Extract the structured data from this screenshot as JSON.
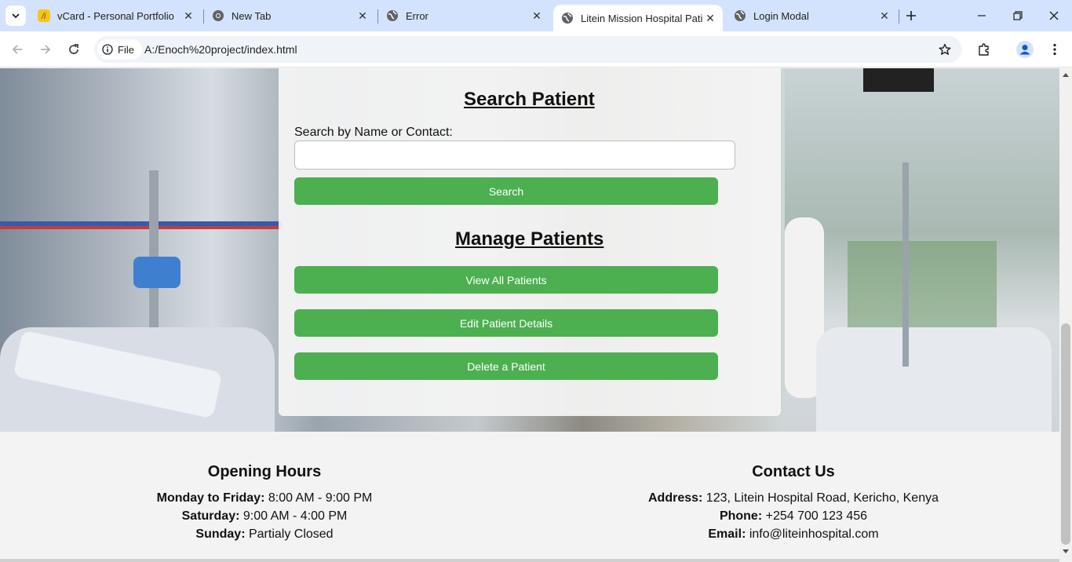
{
  "browser": {
    "tabs": [
      {
        "title": "vCard - Personal Portfolio",
        "icon": "vcard-favicon-icon",
        "active": false
      },
      {
        "title": "New Tab",
        "icon": "chrome-icon",
        "active": false
      },
      {
        "title": "Error",
        "icon": "globe-icon",
        "active": false
      },
      {
        "title": "Litein Mission Hospital Patie",
        "icon": "globe-icon",
        "active": true
      },
      {
        "title": "Login Modal",
        "icon": "globe-icon",
        "active": false
      }
    ],
    "site_info_label": "File",
    "url": "A:/Enoch%20project/index.html"
  },
  "search": {
    "title": "Search Patient",
    "label": "Search by Name or Contact:",
    "value": "",
    "button_label": "Search"
  },
  "manage": {
    "title": "Manage Patients",
    "view_all_label": "View All Patients",
    "edit_label": "Edit Patient Details",
    "delete_label": "Delete a Patient"
  },
  "footer": {
    "hours": {
      "title": "Opening Hours",
      "rows": [
        {
          "label": "Monday to Friday:",
          "value": " 8:00 AM - 9:00 PM"
        },
        {
          "label": "Saturday:",
          "value": " 9:00 AM - 4:00 PM"
        },
        {
          "label": "Sunday:",
          "value": " Partialy Closed"
        }
      ]
    },
    "contact": {
      "title": "Contact Us",
      "rows": [
        {
          "label": "Address:",
          "value": " 123, Litein Hospital Road, Kericho, Kenya"
        },
        {
          "label": "Phone:",
          "value": " +254 700 123 456"
        },
        {
          "label": "Email:",
          "value": " info@liteinhospital.com"
        }
      ]
    }
  },
  "colors": {
    "accent_green": "#4caf50",
    "tabstrip": "#d3e3fd"
  }
}
